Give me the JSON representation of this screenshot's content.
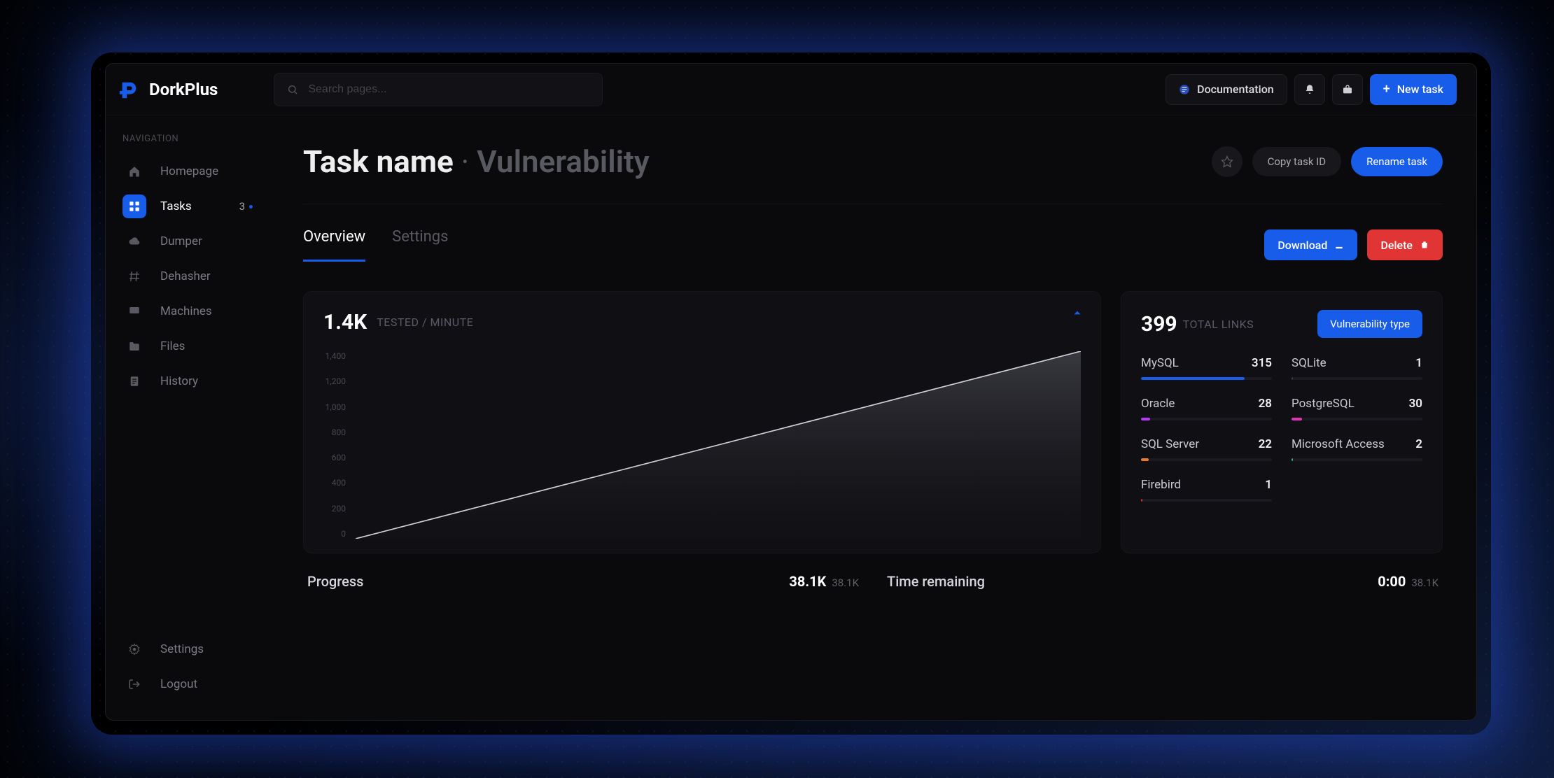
{
  "brand": "DorkPlus",
  "search": {
    "placeholder": "Search pages..."
  },
  "topbar": {
    "doc": "Documentation",
    "new_task": "New task"
  },
  "nav": {
    "label": "NAVIGATION",
    "items": [
      {
        "label": "Homepage"
      },
      {
        "label": "Tasks",
        "badge": "3",
        "active": true
      },
      {
        "label": "Dumper"
      },
      {
        "label": "Dehasher"
      },
      {
        "label": "Machines"
      },
      {
        "label": "Files"
      },
      {
        "label": "History"
      }
    ],
    "bottom": [
      {
        "label": "Settings"
      },
      {
        "label": "Logout"
      }
    ]
  },
  "page": {
    "title": "Task name",
    "subtitle": "Vulnerability",
    "copy": "Copy task ID",
    "rename": "Rename task"
  },
  "tabs": {
    "overview": "Overview",
    "settings": "Settings",
    "download": "Download",
    "delete": "Delete"
  },
  "chart_data": {
    "type": "area",
    "title": "",
    "stat_value": "1.4K",
    "stat_label": "TESTED / MINUTE",
    "ylabel": "",
    "xlabel": "",
    "ylim": [
      0,
      1400
    ],
    "y_ticks": [
      "1,400",
      "1,200",
      "1,000",
      "800",
      "600",
      "400",
      "200",
      "0"
    ],
    "x": [
      0,
      1,
      2,
      3,
      4,
      5,
      6,
      7,
      8,
      9,
      10
    ],
    "values": [
      0,
      140,
      280,
      420,
      560,
      700,
      840,
      980,
      1120,
      1260,
      1400
    ]
  },
  "links": {
    "total": "399",
    "label": "TOTAL LINKS",
    "type_btn": "Vulnerability type",
    "items": [
      {
        "name": "MySQL",
        "count": "315",
        "pct": 79,
        "color": "#175dea"
      },
      {
        "name": "SQLite",
        "count": "1",
        "pct": 1,
        "color": "#3a3a44"
      },
      {
        "name": "Oracle",
        "count": "28",
        "pct": 7,
        "color": "#b43af4"
      },
      {
        "name": "PostgreSQL",
        "count": "30",
        "pct": 8,
        "color": "#e233b5"
      },
      {
        "name": "SQL Server",
        "count": "22",
        "pct": 6,
        "color": "#f07a2c"
      },
      {
        "name": "Microsoft Access",
        "count": "2",
        "pct": 1,
        "color": "#2fbf71"
      },
      {
        "name": "Firebird",
        "count": "1",
        "pct": 1,
        "color": "#e13535"
      }
    ]
  },
  "progress": {
    "label": "Progress",
    "value": "38.1K",
    "small": "38.1K",
    "time_label": "Time remaining",
    "time_value": "0:00",
    "time_small": "38.1K"
  }
}
